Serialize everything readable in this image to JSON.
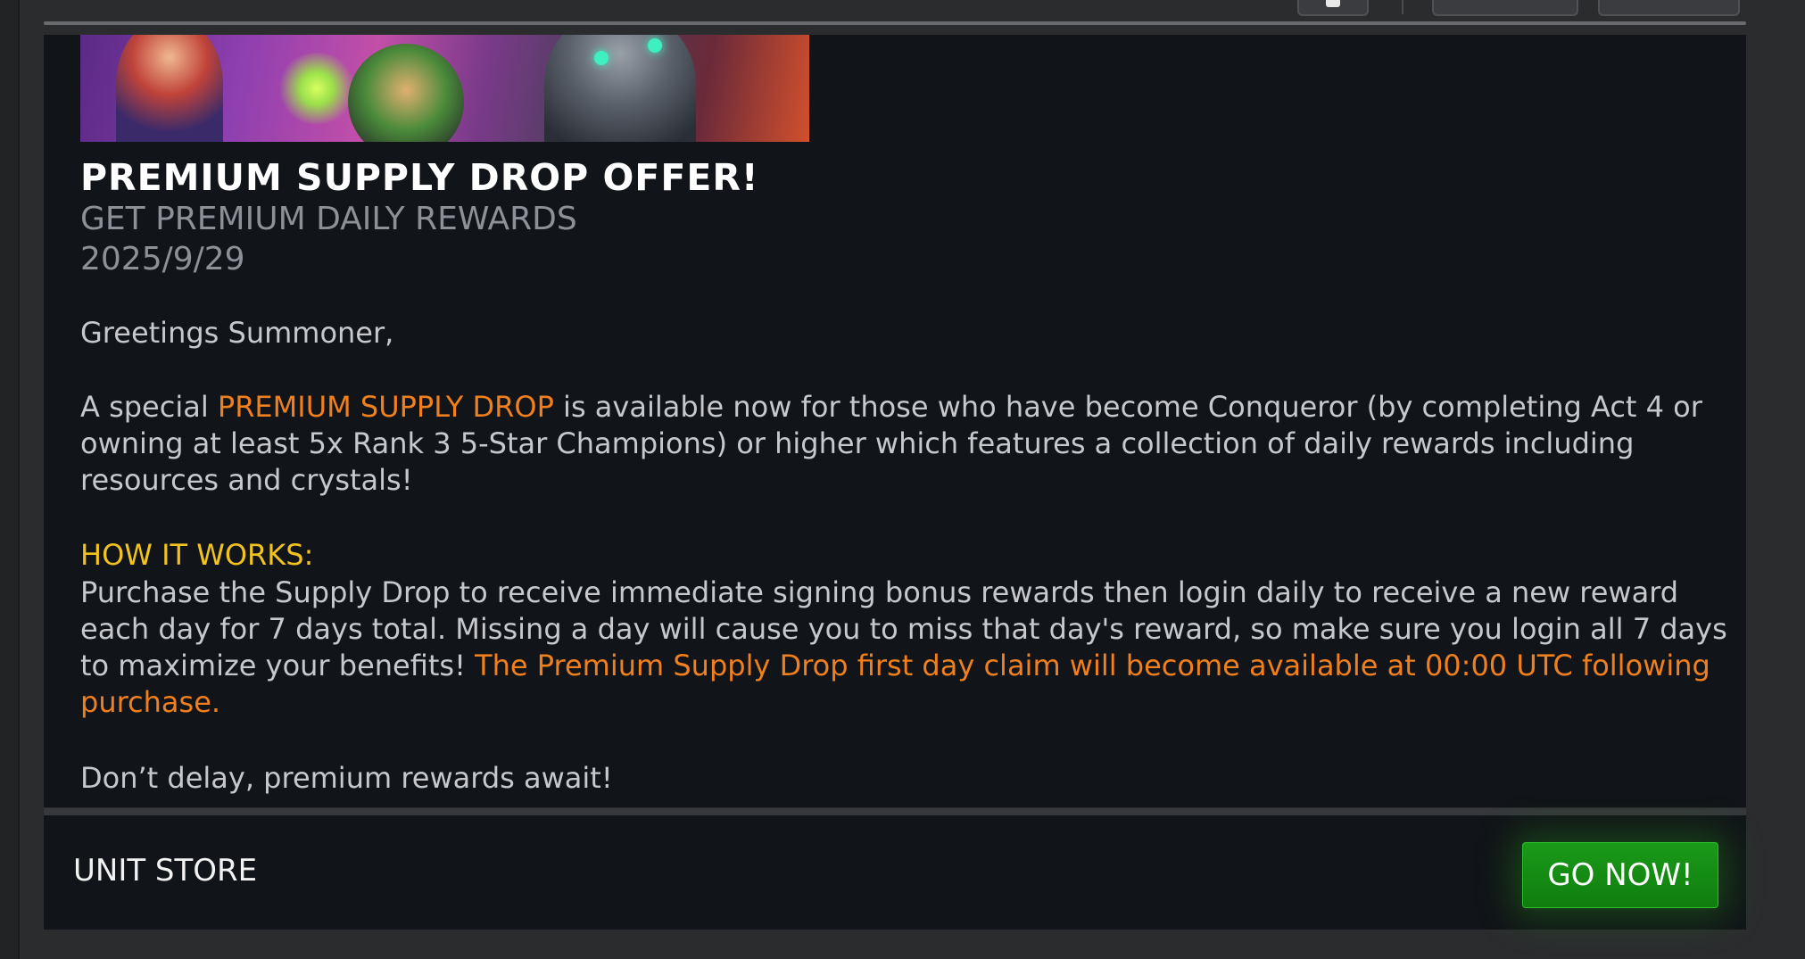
{
  "offer": {
    "title": "PREMIUM SUPPLY DROP OFFER!",
    "subtitle": "GET PREMIUM DAILY REWARDS",
    "date": "2025/9/29",
    "greeting": "Greetings Summoner,",
    "intro_prefix": "A special ",
    "intro_highlight": "PREMIUM SUPPLY DROP",
    "intro_suffix": " is available now for those who have become Conqueror (by completing Act 4 or owning at least 5x Rank 3 5-Star Champions) or higher which features a collection of daily rewards including resources and crystals!",
    "how_heading": "HOW IT WORKS:",
    "how_text": "Purchase the Supply Drop to receive immediate signing bonus rewards then login daily to receive a new reward each day for 7 days total. Missing a day will cause you to miss that day's reward, so make sure you login all 7 days to maximize your benefits! ",
    "how_highlight": "The Premium Supply Drop first day claim will become available at 00:00 UTC following purchase.",
    "closing": "Don’t delay, premium rewards await!"
  },
  "footer": {
    "label": "UNIT STORE",
    "button": "GO NOW!"
  },
  "colors": {
    "highlight_orange": "#f07f1e",
    "heading_yellow": "#f2c21e",
    "button_green": "#1a9a18",
    "panel_bg": "#111418"
  }
}
